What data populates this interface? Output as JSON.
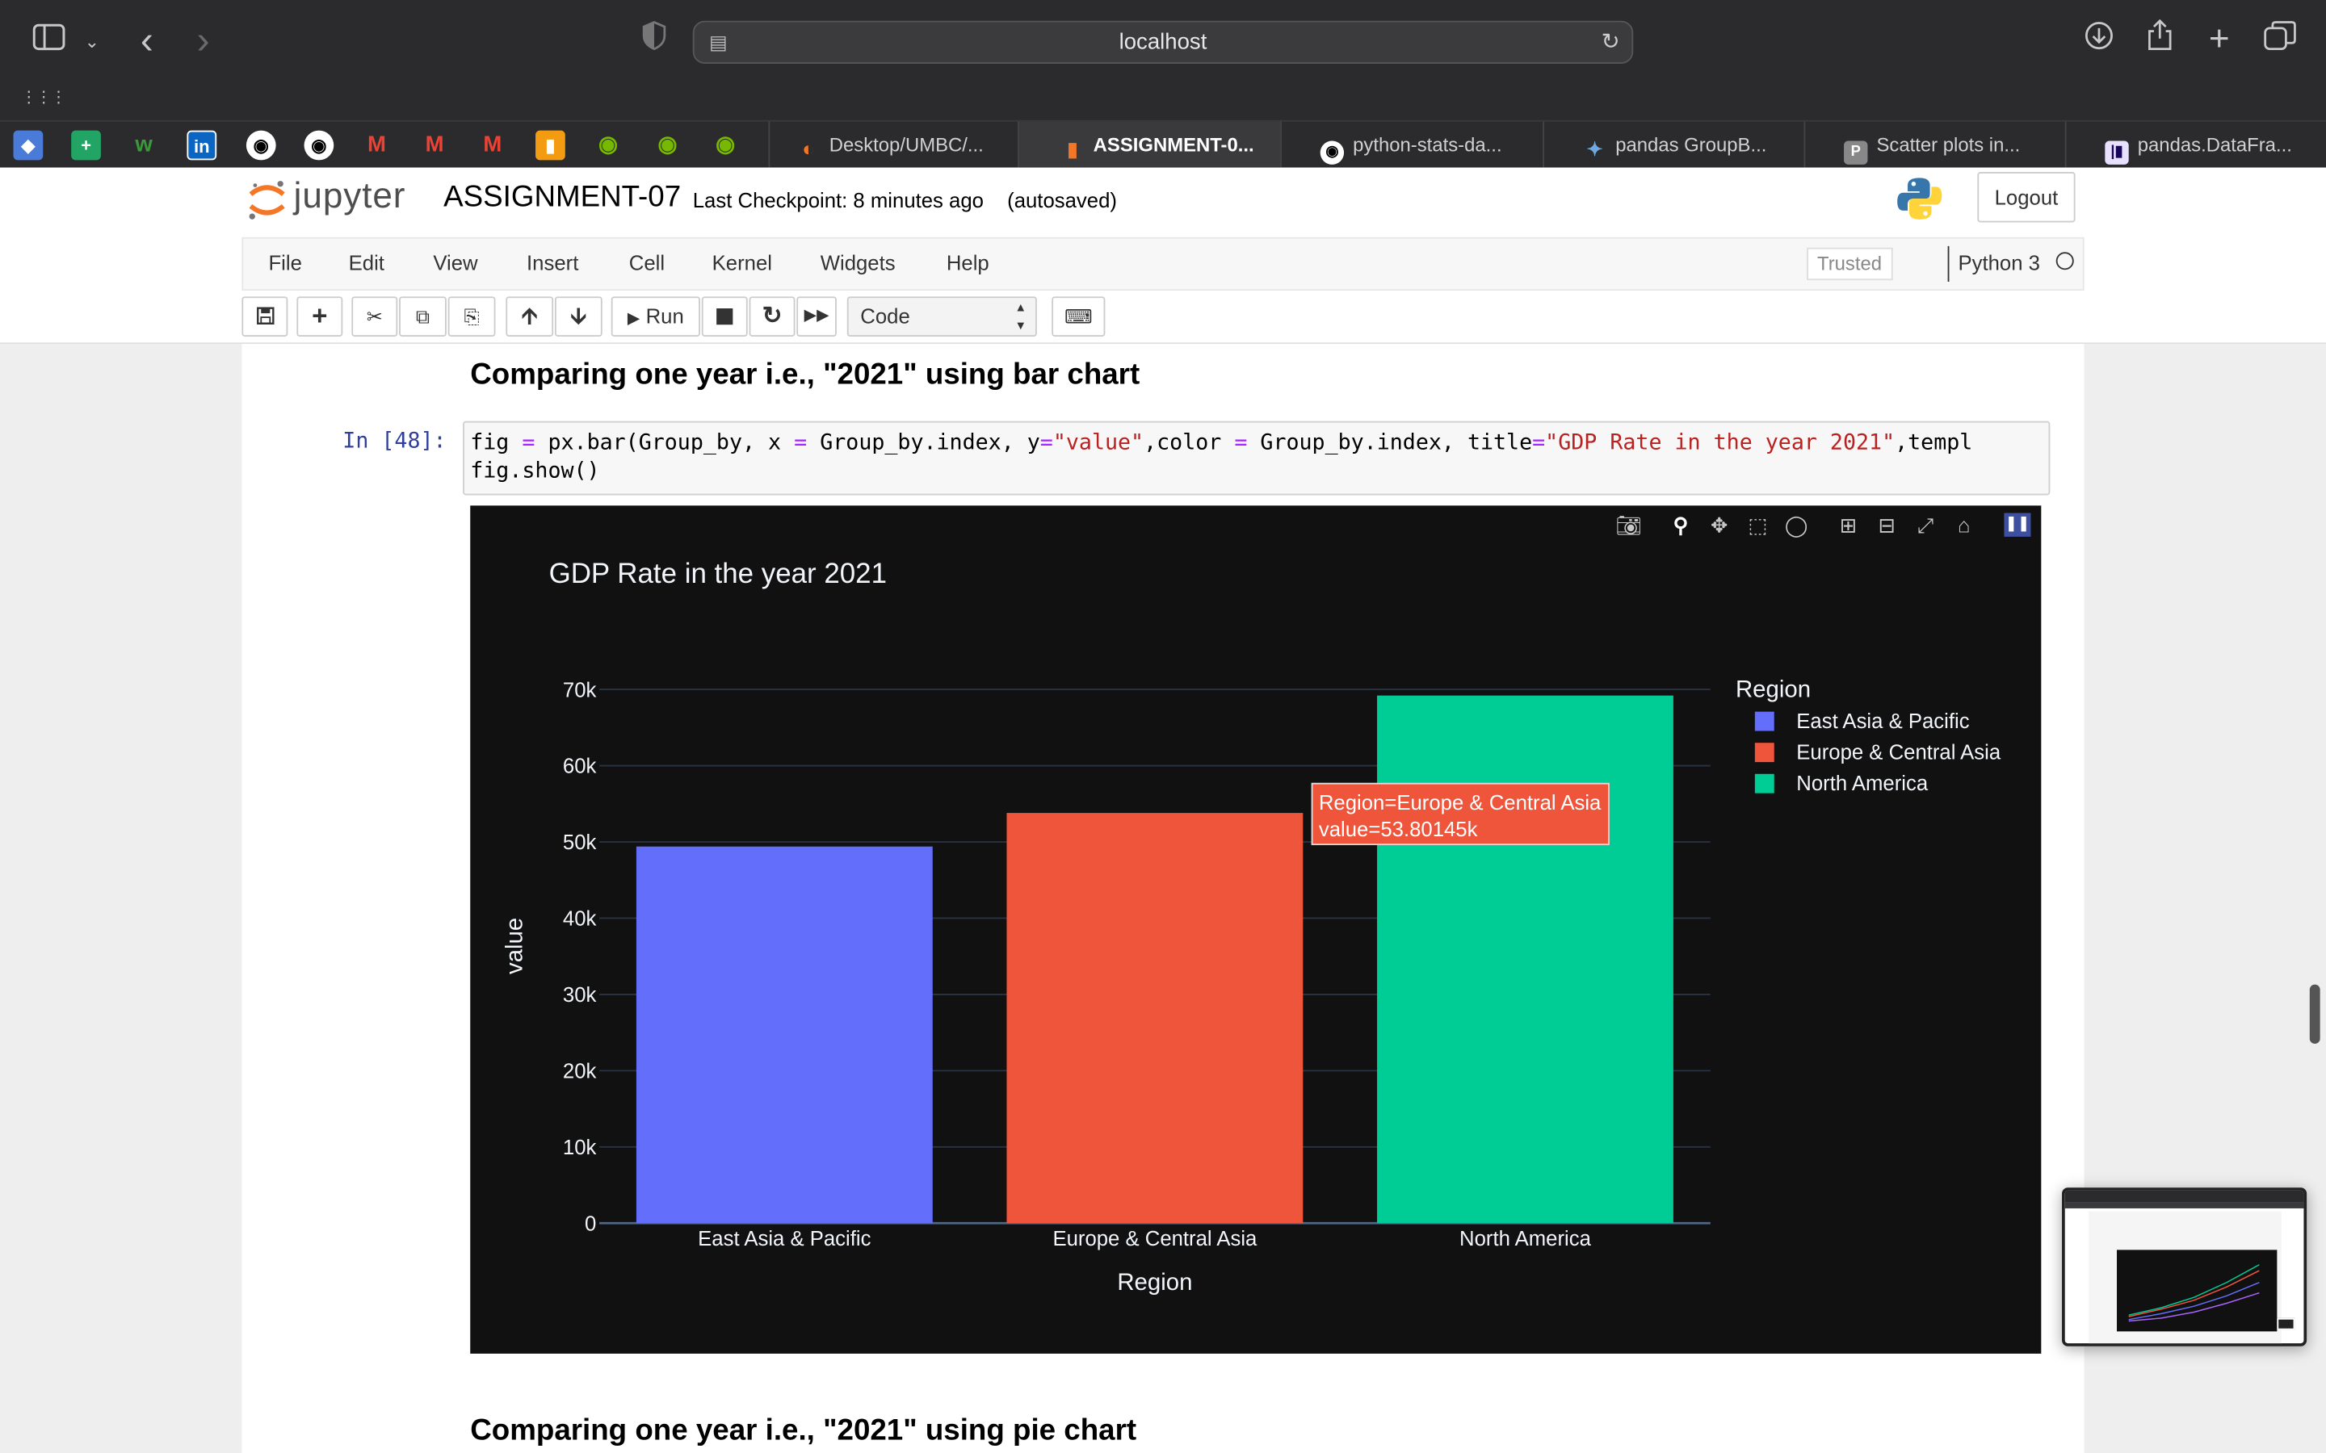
{
  "browser": {
    "url": "localhost",
    "tabs": [
      {
        "label": "Desktop/UMBC/..."
      },
      {
        "label": "ASSIGNMENT-0..."
      },
      {
        "label": "python-stats-da..."
      },
      {
        "label": "pandas GroupB..."
      },
      {
        "label": "Scatter plots in..."
      },
      {
        "label": "pandas.DataFra..."
      }
    ],
    "pinned_tab_letters": [
      "M",
      "M",
      "M"
    ]
  },
  "jupyter": {
    "logo_text": "jupyter",
    "notebook_name": "ASSIGNMENT-07",
    "checkpoint": "Last Checkpoint: 8 minutes ago",
    "autosaved": "(autosaved)",
    "logout": "Logout",
    "menu": [
      "File",
      "Edit",
      "View",
      "Insert",
      "Cell",
      "Kernel",
      "Widgets",
      "Help"
    ],
    "trusted": "Trusted",
    "kernel": "Python 3",
    "run_label": "Run",
    "cell_type": "Code"
  },
  "notebook": {
    "heading1": "Comparing one year i.e., \"2021\" using bar chart",
    "prompt": "In [48]:",
    "code_line1": {
      "a": "fig ",
      "b": "=",
      "c": " px.bar(Group_by, x ",
      "d": "=",
      "e": " Group_by.index, y",
      "f": "=",
      "g": "\"value\"",
      "h": ",color ",
      "i": "=",
      "j": " Group_by.index, title",
      "k": "=",
      "l": "\"GDP Rate in the year 2021\"",
      "m": ",templ"
    },
    "code_line2": "fig.show()",
    "heading2": "Comparing one year i.e., \"2021\" using pie chart"
  },
  "chart_data": {
    "type": "bar",
    "title": "GDP Rate in the year 2021",
    "xlabel": "Region",
    "ylabel": "value",
    "categories": [
      "East Asia & Pacific",
      "Europe & Central Asia",
      "North America"
    ],
    "values": [
      49400,
      53801.45,
      69200
    ],
    "colors": [
      "#636efa",
      "#ef553b",
      "#00cc96"
    ],
    "ylim": [
      0,
      72000
    ],
    "yticks": [
      0,
      10000,
      20000,
      30000,
      40000,
      50000,
      60000,
      70000
    ],
    "ytick_labels": [
      "0",
      "10k",
      "20k",
      "30k",
      "40k",
      "50k",
      "60k",
      "70k"
    ],
    "legend_title": "Region",
    "legend": [
      "East Asia & Pacific",
      "Europe & Central Asia",
      "North America"
    ],
    "legend_position": "right",
    "grid": true,
    "background": "#111111",
    "tooltip": {
      "line1": "Region=Europe & Central Asia",
      "line2": "value=53.80145k"
    }
  }
}
